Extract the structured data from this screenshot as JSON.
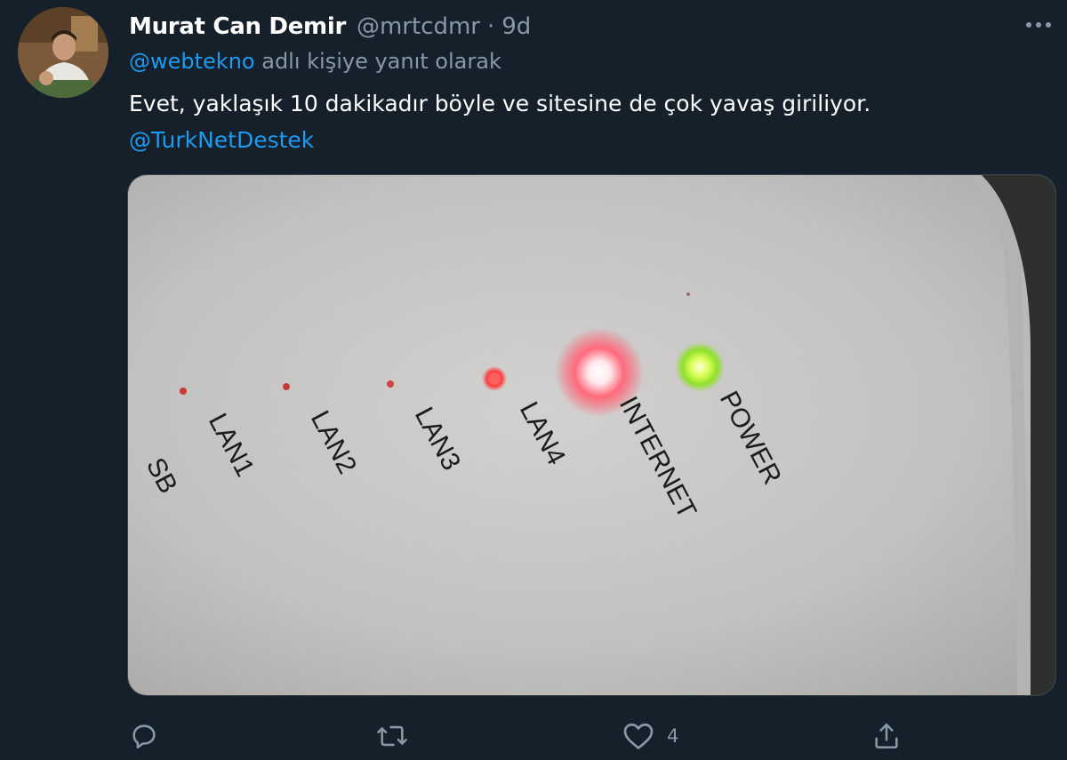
{
  "author": {
    "name": "Murat Can Demir",
    "handle": "@mrtcdmr",
    "separator": "·",
    "time": "9d",
    "avatar_icon": "profile-photo"
  },
  "reply_context": {
    "mention": "@webtekno",
    "suffix": " adlı kişiye yanıt olarak"
  },
  "body": {
    "text": "Evet, yaklaşık 10 dakikadır böyle ve sitesine de çok yavaş giriliyor.",
    "mention": "@TurkNetDestek"
  },
  "media": {
    "labels": [
      "SB",
      "LAN1",
      "LAN2",
      "LAN3",
      "LAN4",
      "INTERNET",
      "POWER"
    ],
    "led_colors": {
      "internet": "#ff5a6e",
      "power": "#b6ff3a",
      "dim": "#ff3b3b"
    }
  },
  "actions": {
    "reply_icon": "reply-icon",
    "retweet_icon": "retweet-icon",
    "like_icon": "heart-icon",
    "like_count": "4",
    "share_icon": "share-icon"
  },
  "colors": {
    "background": "#15202b",
    "secondary_text": "#8899a6",
    "link": "#1d9bf0"
  }
}
